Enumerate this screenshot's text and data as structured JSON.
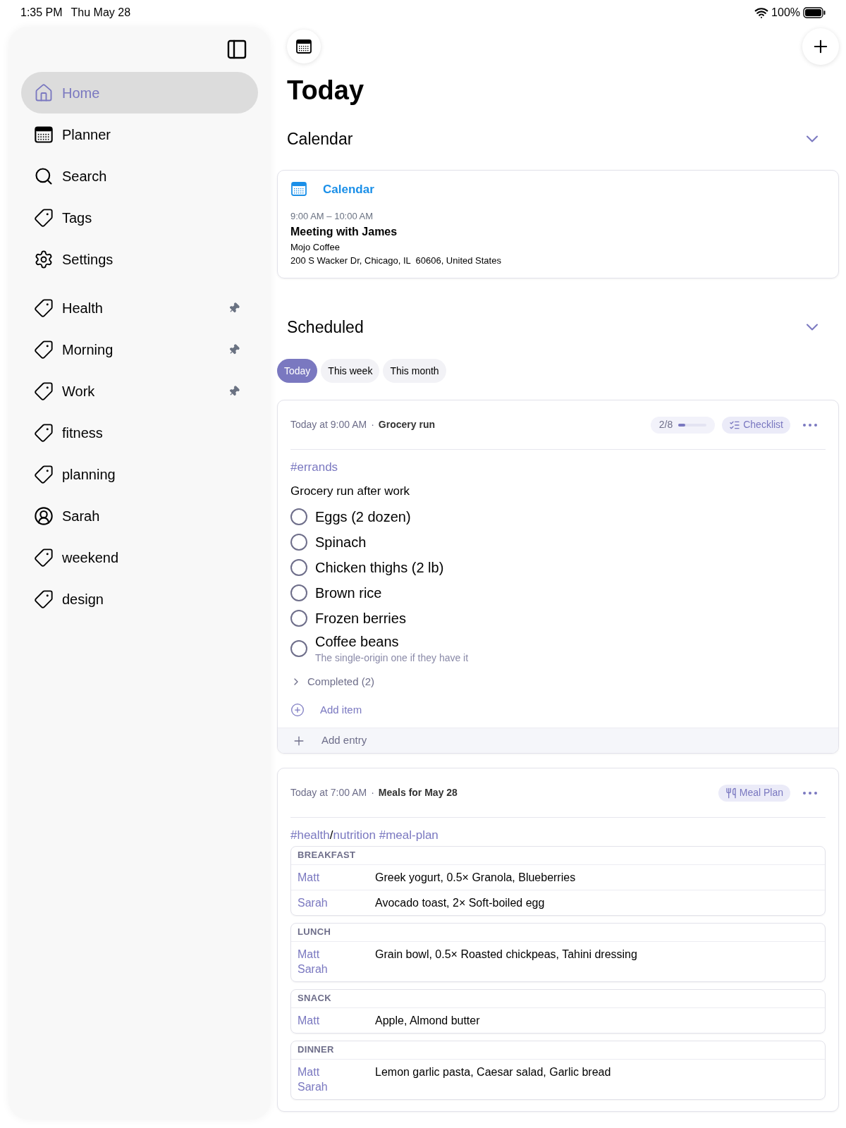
{
  "status_bar": {
    "time": "1:35 PM",
    "date": "Thu May 28",
    "battery": "100%"
  },
  "sidebar": {
    "items": [
      {
        "label": "Home",
        "kind": "home",
        "selected": true,
        "pinned": false
      },
      {
        "label": "Planner",
        "kind": "planner",
        "selected": false,
        "pinned": false
      },
      {
        "label": "Search",
        "kind": "search",
        "selected": false,
        "pinned": false
      },
      {
        "label": "Tags",
        "kind": "tag",
        "selected": false,
        "pinned": false
      },
      {
        "label": "Settings",
        "kind": "settings",
        "selected": false,
        "pinned": false
      },
      {
        "label": "Health",
        "kind": "tag",
        "selected": false,
        "pinned": true
      },
      {
        "label": "Morning",
        "kind": "tag",
        "selected": false,
        "pinned": true
      },
      {
        "label": "Work",
        "kind": "tag",
        "selected": false,
        "pinned": true
      },
      {
        "label": "fitness",
        "kind": "tag",
        "selected": false,
        "pinned": false
      },
      {
        "label": "planning",
        "kind": "tag",
        "selected": false,
        "pinned": false
      },
      {
        "label": "Sarah",
        "kind": "person",
        "selected": false,
        "pinned": false
      },
      {
        "label": "weekend",
        "kind": "tag",
        "selected": false,
        "pinned": false
      },
      {
        "label": "design",
        "kind": "tag",
        "selected": false,
        "pinned": false
      }
    ]
  },
  "page": {
    "title": "Today"
  },
  "calendar_section": {
    "title": "Calendar",
    "expanded": true,
    "card": {
      "source": "Calendar",
      "time": "9:00 AM – 10:00 AM",
      "event": "Meeting with James",
      "location": "Mojo Coffee",
      "address": "200 S Wacker Dr, Chicago, IL  60606, United States"
    }
  },
  "scheduled_section": {
    "title": "Scheduled",
    "expanded": true,
    "tabs": [
      {
        "label": "Today",
        "selected": true
      },
      {
        "label": "This week",
        "selected": false
      },
      {
        "label": "This month",
        "selected": false
      }
    ],
    "entries": [
      {
        "kind": "checklist",
        "when": "Today at 9:00 AM",
        "separator": "·",
        "title": "Grocery run",
        "progress": {
          "text": "2/8",
          "level": 0.25
        },
        "badge": "Checklist",
        "tags": [
          {
            "text": "#errands",
            "kind": "tag"
          }
        ],
        "note": "Grocery run after work",
        "items": [
          {
            "label": "Eggs (2 dozen)",
            "checked": false
          },
          {
            "label": "Spinach",
            "checked": false
          },
          {
            "label": "Chicken thighs (2 lb)",
            "checked": false
          },
          {
            "label": "Brown rice",
            "checked": false
          },
          {
            "label": "Frozen berries",
            "checked": false
          },
          {
            "label": "Coffee beans",
            "checked": false,
            "note": "The single-origin one if they have it"
          }
        ],
        "completed": {
          "label": "Completed (2)",
          "expanded": false
        },
        "add_item": "Add item",
        "add_entry": "Add entry"
      },
      {
        "kind": "meal_plan",
        "when": "Today at 7:00 AM",
        "separator": "·",
        "title": "Meals for May 28",
        "badge": "Meal Plan",
        "tags": [
          {
            "text": "#health",
            "kind": "tag"
          },
          {
            "text": "/",
            "kind": "plain"
          },
          {
            "text": "nutrition #meal-plan",
            "kind": "tag"
          }
        ],
        "meals": [
          {
            "name": "BREAKFAST",
            "rows": [
              {
                "people": [
                  "Matt"
                ],
                "food": "Greek yogurt, 0.5× Granola, Blueberries"
              },
              {
                "people": [
                  "Sarah"
                ],
                "food": "Avocado toast, 2× Soft-boiled egg"
              }
            ]
          },
          {
            "name": "LUNCH",
            "rows": [
              {
                "people": [
                  "Matt",
                  "Sarah"
                ],
                "food": "Grain bowl, 0.5× Roasted chickpeas, Tahini dressing"
              }
            ]
          },
          {
            "name": "SNACK",
            "rows": [
              {
                "people": [
                  "Matt"
                ],
                "food": "Apple, Almond butter"
              }
            ]
          },
          {
            "name": "DINNER",
            "rows": [
              {
                "people": [
                  "Matt",
                  "Sarah"
                ],
                "food": "Lemon garlic pasta, Caesar salad, Garlic bread"
              }
            ]
          }
        ]
      }
    ]
  }
}
